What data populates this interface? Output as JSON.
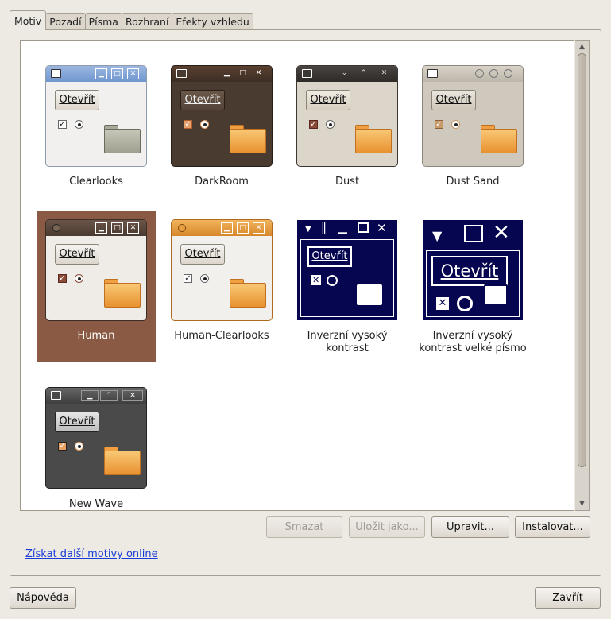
{
  "tabs": [
    {
      "label": "Motiv",
      "active": true
    },
    {
      "label": "Pozadí"
    },
    {
      "label": "Písma"
    },
    {
      "label": "Rozhraní"
    },
    {
      "label": "Efekty vzhledu"
    }
  ],
  "preview_button_label": "Otevřít",
  "themes": [
    {
      "name": "Clearlooks"
    },
    {
      "name": "DarkRoom"
    },
    {
      "name": "Dust"
    },
    {
      "name": "Dust Sand"
    },
    {
      "name": "Human",
      "selected": true
    },
    {
      "name": "Human-Clearlooks"
    },
    {
      "name": "Inverzní vysoký kontrast"
    },
    {
      "name": "Inverzní vysoký kontrast velké písmo"
    },
    {
      "name": "New Wave"
    }
  ],
  "actions": {
    "delete": "Smazat",
    "save_as": "Uložit jako...",
    "edit": "Upravit...",
    "install": "Instalovat..."
  },
  "online_link": "Získat další motivy online",
  "footer": {
    "help": "Nápověda",
    "close": "Zavřít"
  },
  "colors": {
    "selection": "#8a5a44",
    "link": "#1a3cd6",
    "human_orange": "#e8912f",
    "high_contrast_bg": "#050550"
  }
}
